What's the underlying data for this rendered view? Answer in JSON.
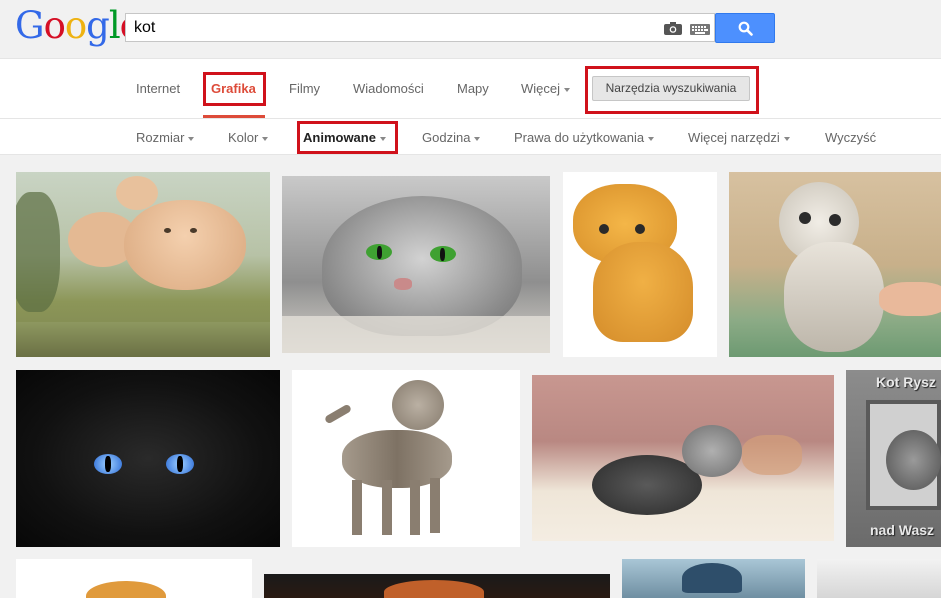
{
  "logo": {
    "letters": [
      {
        "ch": "G",
        "color": "#3369e8"
      },
      {
        "ch": "o",
        "color": "#d50f25"
      },
      {
        "ch": "o",
        "color": "#eeb211"
      },
      {
        "ch": "g",
        "color": "#3369e8"
      },
      {
        "ch": "l",
        "color": "#009925"
      },
      {
        "ch": "e",
        "color": "#d50f25"
      }
    ]
  },
  "search": {
    "query": "kot"
  },
  "tabs": {
    "internet": "Internet",
    "grafika": "Grafika",
    "filmy": "Filmy",
    "wiadomosci": "Wiadomości",
    "mapy": "Mapy",
    "wiecej": "Więcej",
    "tools": "Narzędzia wyszukiwania"
  },
  "tools": {
    "rozmiar": "Rozmiar",
    "kolor": "Kolor",
    "animowane": "Animowane",
    "godzina": "Godzina",
    "prawa": "Prawa do użytkowania",
    "wiecej_narzedzi": "Więcej narzędzi",
    "wyczysc": "Wyczyść"
  },
  "watermarks": {
    "top": "Kot Rysz",
    "bottom": "nad Wasz"
  },
  "colors": {
    "accent_red": "#dd4b39",
    "highlight_red": "#d0111b",
    "search_blue": "#4d90fe"
  }
}
